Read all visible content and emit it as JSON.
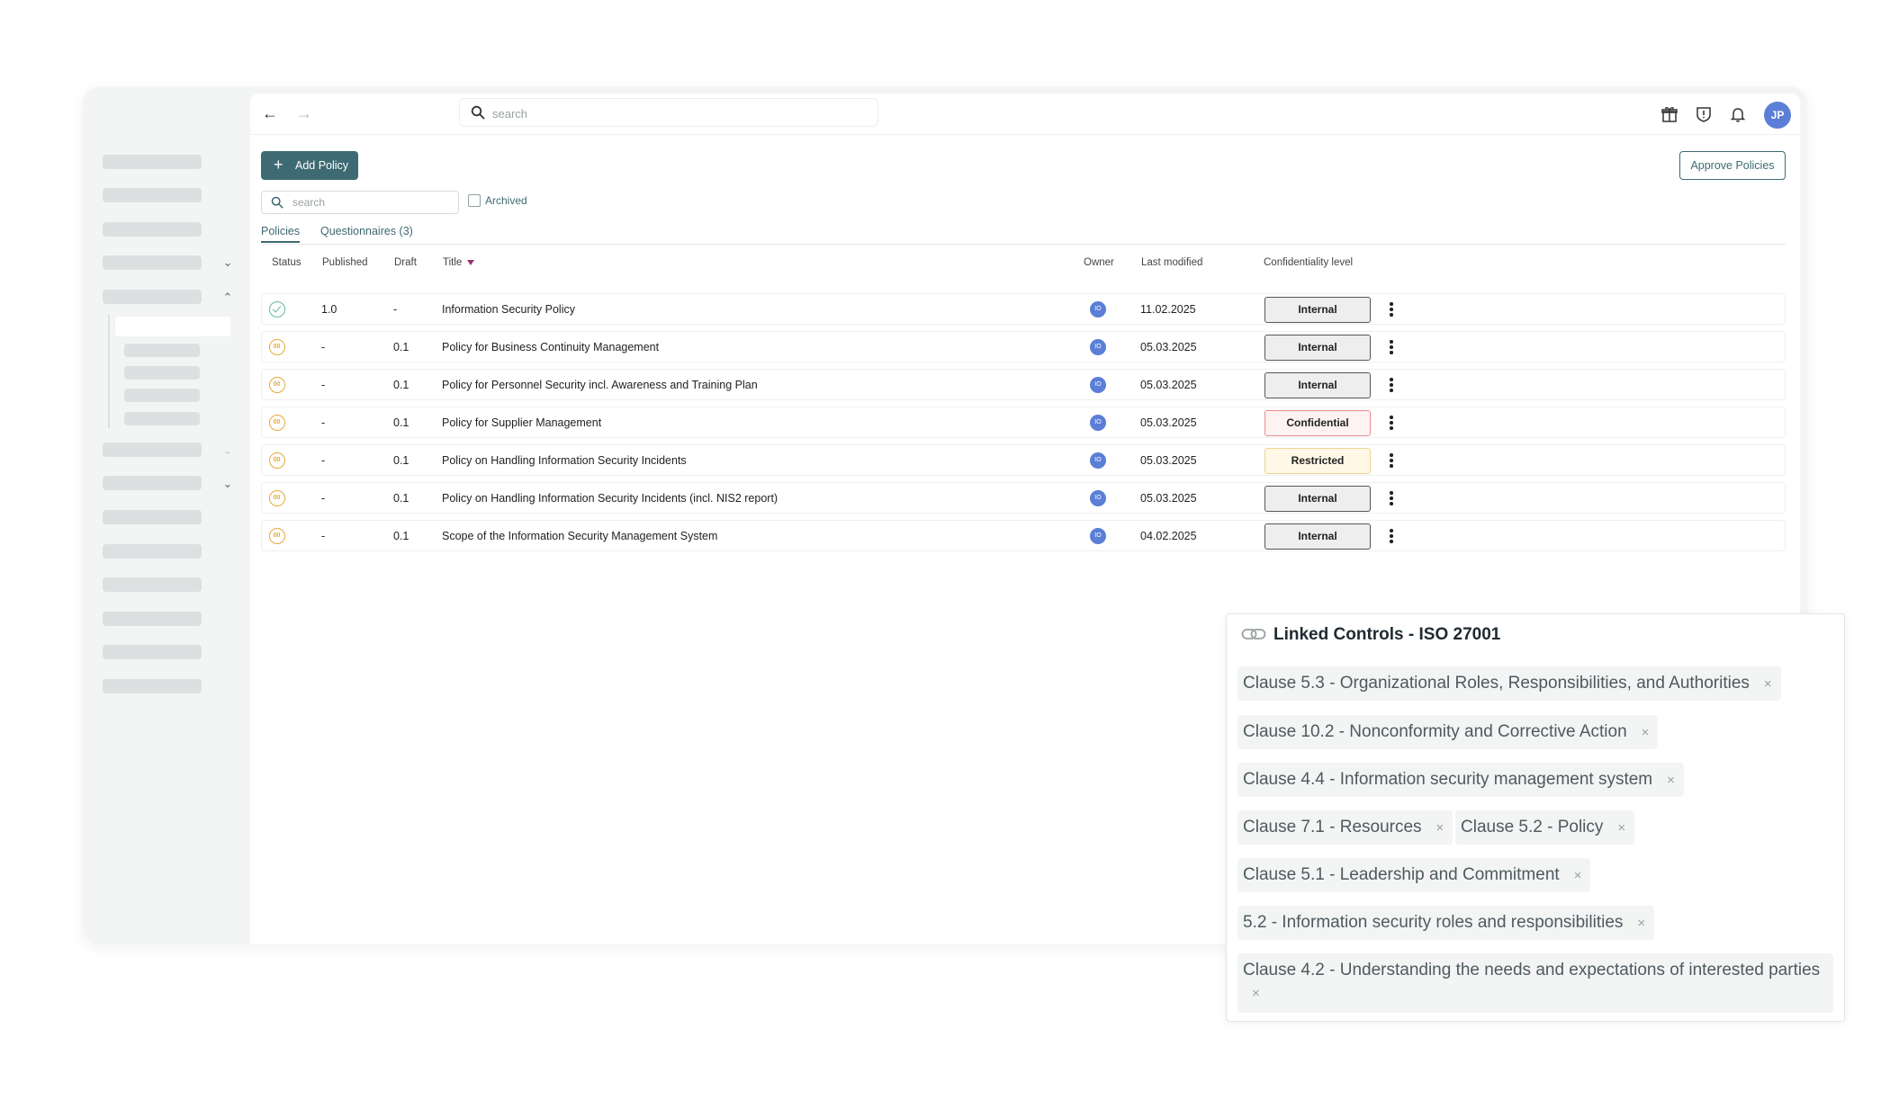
{
  "topbar": {
    "search_placeholder": "search",
    "user_initials": "JP"
  },
  "toolbar": {
    "add_label": "Add Policy",
    "approve_label": "Approve Policies",
    "search_placeholder": "search",
    "archived_label": "Archived"
  },
  "tabs": [
    {
      "label": "Policies",
      "active": true
    },
    {
      "label": "Questionnaires (3)",
      "active": false
    }
  ],
  "table": {
    "columns": [
      "Status",
      "Published",
      "Draft",
      "Title",
      "Owner",
      "Last modified",
      "Confidentiality level"
    ],
    "rows": [
      {
        "status": "published",
        "published": "1.0",
        "draft": "-",
        "title": "Information Security Policy",
        "owner": "IO",
        "last_modified": "11.02.2025",
        "confidentiality": "Internal"
      },
      {
        "status": "draft",
        "published": "-",
        "draft": "0.1",
        "title": "Policy for Business Continuity Management",
        "owner": "IO",
        "last_modified": "05.03.2025",
        "confidentiality": "Internal"
      },
      {
        "status": "draft",
        "published": "-",
        "draft": "0.1",
        "title": "Policy for Personnel Security incl. Awareness and Training Plan",
        "owner": "IO",
        "last_modified": "05.03.2025",
        "confidentiality": "Internal"
      },
      {
        "status": "draft",
        "published": "-",
        "draft": "0.1",
        "title": "Policy for Supplier Management",
        "owner": "IO",
        "last_modified": "05.03.2025",
        "confidentiality": "Confidential"
      },
      {
        "status": "draft",
        "published": "-",
        "draft": "0.1",
        "title": "Policy on Handling Information Security Incidents",
        "owner": "IO",
        "last_modified": "05.03.2025",
        "confidentiality": "Restricted"
      },
      {
        "status": "draft",
        "published": "-",
        "draft": "0.1",
        "title": "Policy on Handling Information Security Incidents (incl. NIS2 report)",
        "owner": "IO",
        "last_modified": "05.03.2025",
        "confidentiality": "Internal"
      },
      {
        "status": "draft",
        "published": "-",
        "draft": "0.1",
        "title": "Scope of the Information Security Management System",
        "owner": "IO",
        "last_modified": "04.02.2025",
        "confidentiality": "Internal"
      }
    ]
  },
  "linked_controls": {
    "title": "Linked Controls - ISO 27001",
    "chips": [
      "Clause 5.3 - Organizational Roles, Responsibilities, and Authorities",
      "Clause 10.2 - Nonconformity and Corrective Action",
      "Clause 4.4 - Information security management system",
      "Clause 7.1 - Resources",
      "Clause 5.2 - Policy",
      "Clause 5.1 - Leadership and Commitment",
      "5.2 - Information security roles and responsibilities",
      "Clause 4.2 - Understanding the needs and expectations of interested parties"
    ],
    "remove_symbol": "×"
  }
}
